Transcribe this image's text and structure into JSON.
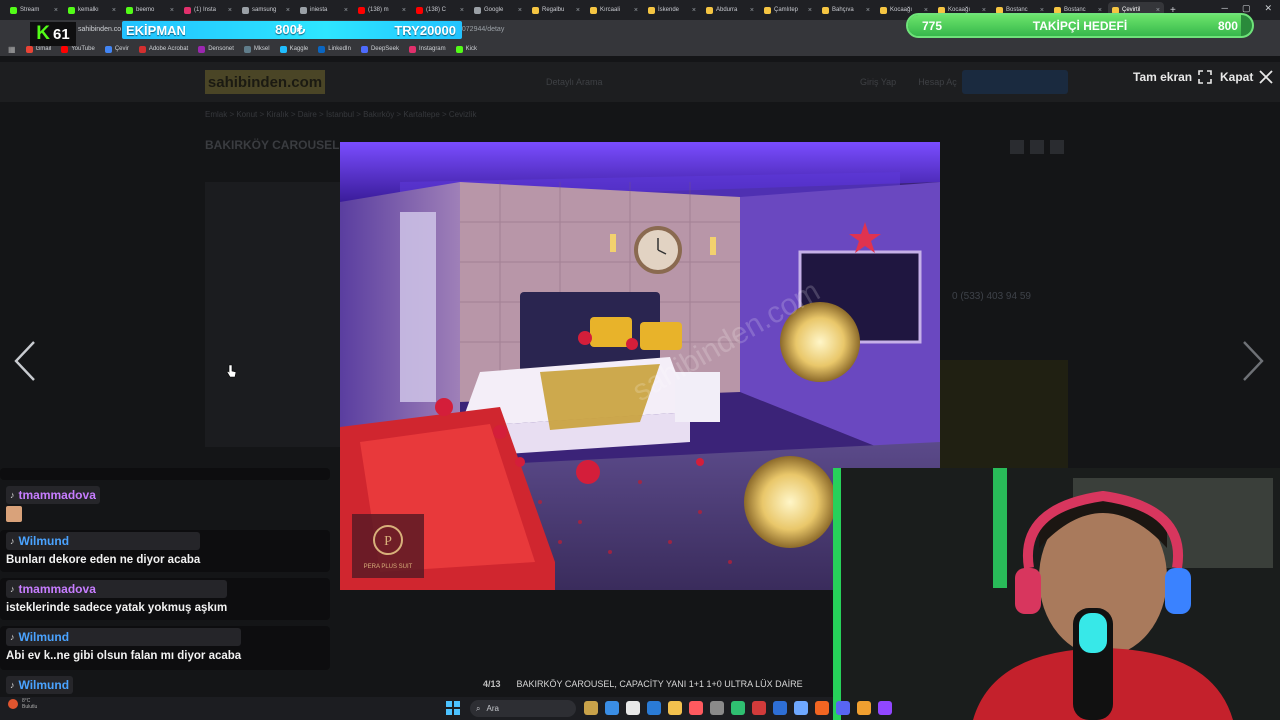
{
  "browser": {
    "tabs": [
      {
        "label": "Stream",
        "color": "#53fc18",
        "active": false
      },
      {
        "label": "kemalkı",
        "color": "#53fc18",
        "active": false
      },
      {
        "label": "beemo",
        "color": "#53fc18",
        "active": false
      },
      {
        "label": "(1) Insta",
        "color": "#e1306c",
        "active": false
      },
      {
        "label": "samsung",
        "color": "#9aa0a6",
        "active": false
      },
      {
        "label": "iniesta",
        "color": "#9aa0a6",
        "active": false
      },
      {
        "label": "(138) m",
        "color": "#ff0000",
        "active": false
      },
      {
        "label": "(138) C",
        "color": "#ff0000",
        "active": false
      },
      {
        "label": "Google",
        "color": "#9aa0a6",
        "active": false
      },
      {
        "label": "Regalbu",
        "color": "#f5c542",
        "active": false
      },
      {
        "label": "Kırcaali",
        "color": "#f5c542",
        "active": false
      },
      {
        "label": "İskende",
        "color": "#f5c542",
        "active": false
      },
      {
        "label": "Abdurra",
        "color": "#f5c542",
        "active": false
      },
      {
        "label": "Çamlıtep",
        "color": "#f5c542",
        "active": false
      },
      {
        "label": "Bahçıva",
        "color": "#f5c542",
        "active": false
      },
      {
        "label": "Kocaağı",
        "color": "#f5c542",
        "active": false
      },
      {
        "label": "Kocaağı",
        "color": "#f5c542",
        "active": false
      },
      {
        "label": "Bostanc",
        "color": "#f5c542",
        "active": false
      },
      {
        "label": "Bostanc",
        "color": "#f5c542",
        "active": false
      },
      {
        "label": "Çevirtil",
        "color": "#f5c542",
        "active": true
      }
    ],
    "new_tab": "+",
    "url_host": "sahibinden.co",
    "url_tail": "4072944/detay",
    "bookmarks": [
      {
        "label": "Gmail",
        "color": "#ea4335"
      },
      {
        "label": "YouTube",
        "color": "#ff0000"
      },
      {
        "label": "Çevir",
        "color": "#4285f4"
      },
      {
        "label": "Adobe Acrobat",
        "color": "#d32f2f"
      },
      {
        "label": "Densonet",
        "color": "#9c27b0"
      },
      {
        "label": "Mksel",
        "color": "#607d8b"
      },
      {
        "label": "Kaggle",
        "color": "#20beff"
      },
      {
        "label": "LinkedIn",
        "color": "#0a66c2"
      },
      {
        "label": "DeepSeek",
        "color": "#4d6bfe"
      },
      {
        "label": "Instagram",
        "color": "#e1306c"
      },
      {
        "label": "Kick",
        "color": "#53fc18"
      }
    ]
  },
  "overlay": {
    "kick_number": "61",
    "ticker_label": "EKİPMAN",
    "ticker_price": "800₺",
    "ticker_amount": "TRY20000",
    "goal_current": "775",
    "goal_label": "TAKİPÇİ HEDEFİ",
    "goal_target": "800",
    "goal_progress": 0.969
  },
  "site": {
    "logo": "sahibinden.com",
    "search_placeholder": "Detaylı Arama",
    "header_links": [
      "Giriş Yap",
      "Hesap Aç"
    ],
    "breadcrumbs": "Emlak > Konut > Kiralık > Daire > İstanbul > Bakırköy > Kartaltepe > Cevizlik",
    "title": "BAKIRKÖY CAROUSEL",
    "phone": "0 (533) 403 94 59"
  },
  "lightbox": {
    "fullscreen_label": "Tam ekran",
    "close_label": "Kapat",
    "counter": "4/13",
    "caption": "BAKIRKÖY CAROUSEL, CAPACİTY YANI 1+1 1+0 ULTRA LÜX DAİRE",
    "watermark": "sahibinden.com",
    "logo_text": "PERA PLUS SUIT"
  },
  "chat": [
    {
      "user": "tmammadova",
      "user_color": "#c77dff",
      "message": ""
    },
    {
      "user": "Wilmund",
      "user_color": "#4aa3ff",
      "message": "Bunları dekore eden ne diyor acaba"
    },
    {
      "user": "tmammadova",
      "user_color": "#c77dff",
      "message": "isteklerinde sadece yatak yokmuş aşkım"
    },
    {
      "user": "Wilmund",
      "user_color": "#4aa3ff",
      "message": "Abi ev k..ne gibi olsun falan mı diyor acaba"
    },
    {
      "user": "Wilmund",
      "user_color": "#4aa3ff",
      "message": ""
    }
  ],
  "taskbar": {
    "search_label": "Ara",
    "weather_temp": "8°C",
    "weather_desc": "Bulutlu",
    "apps": [
      "#c8a24a",
      "#3a8ee6",
      "#e8e8e8",
      "#2a7bd6",
      "#f2c14e",
      "#ff5a5f",
      "#8a8a8a",
      "#2fbf71",
      "#d13b3b",
      "#2e6fd6",
      "#6fa8ff",
      "#f26522",
      "#5865f2",
      "#f0a030",
      "#9147ff"
    ]
  }
}
